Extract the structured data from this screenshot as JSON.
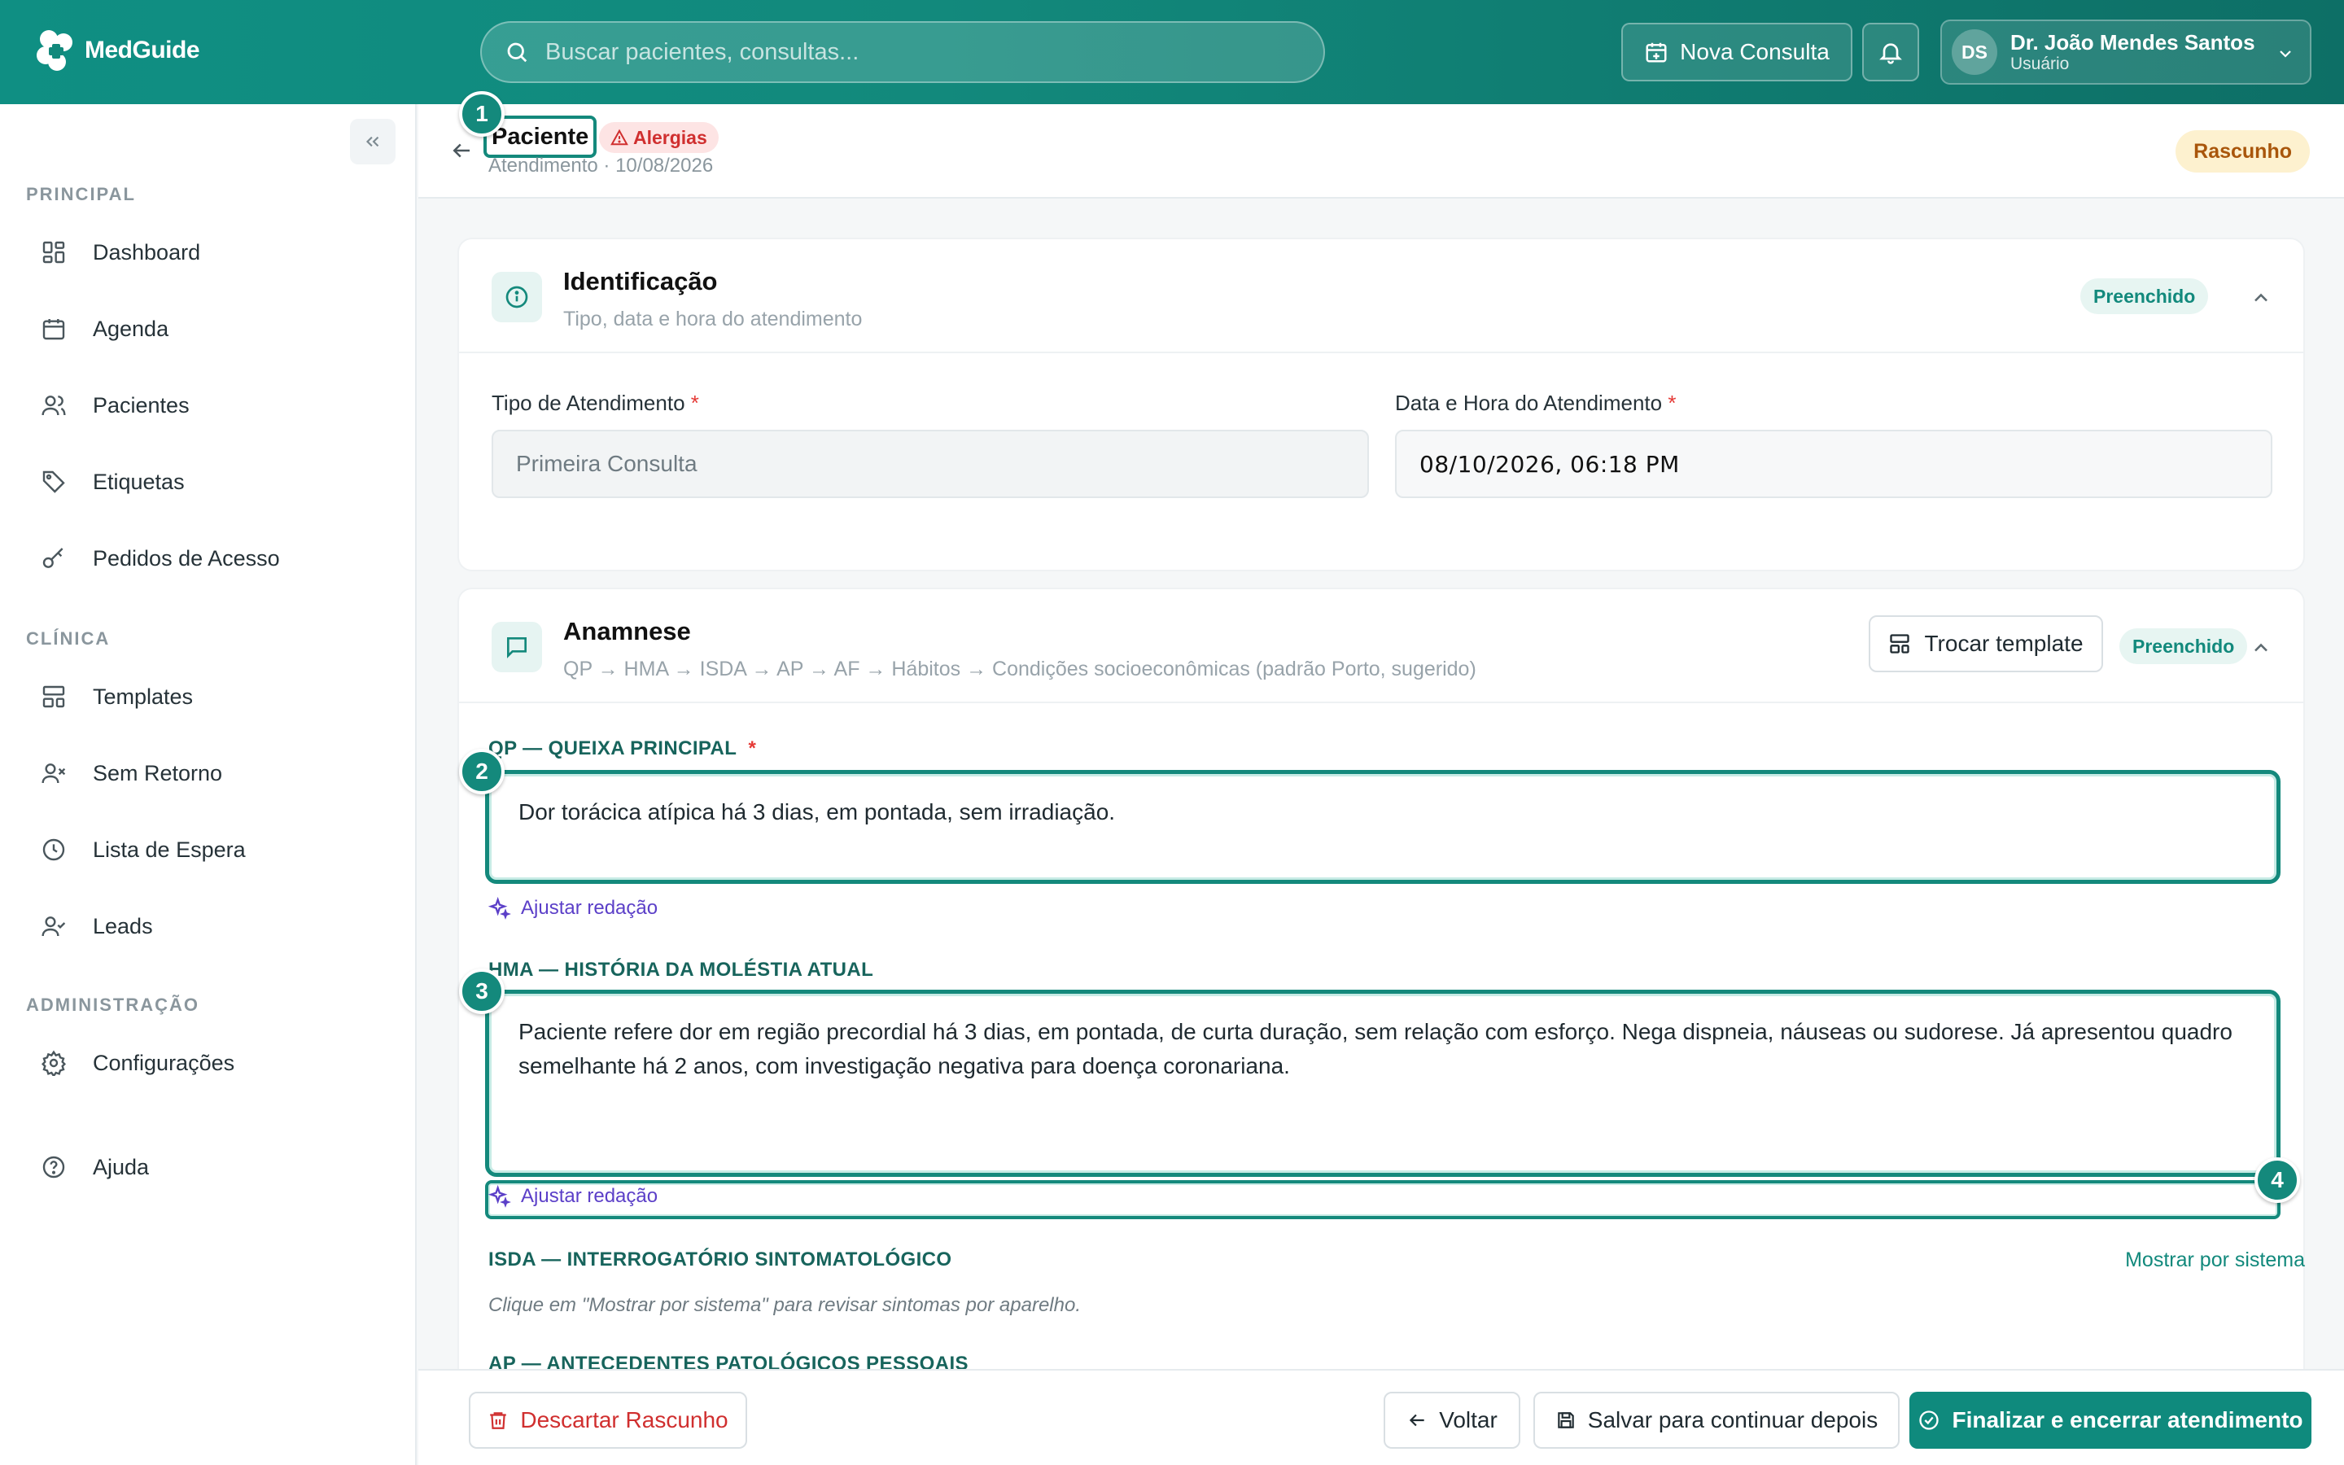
{
  "app": {
    "name": "MedGuide"
  },
  "topbar": {
    "search_placeholder": "Buscar pacientes, consultas...",
    "new_consult_label": "Nova Consulta",
    "user": {
      "initials": "DS",
      "name": "Dr. João Mendes Santos",
      "role": "Usuário"
    }
  },
  "sidebar": {
    "sections": {
      "principal": "PRINCIPAL",
      "clinica": "CLÍNICA",
      "admin": "ADMINISTRAÇÃO"
    },
    "items": [
      {
        "label": "Dashboard",
        "icon": "dashboard-icon"
      },
      {
        "label": "Agenda",
        "icon": "calendar-icon"
      },
      {
        "label": "Pacientes",
        "icon": "users-icon"
      },
      {
        "label": "Etiquetas",
        "icon": "tag-icon"
      },
      {
        "label": "Pedidos de Acesso",
        "icon": "key-icon"
      },
      {
        "label": "Templates",
        "icon": "template-icon"
      },
      {
        "label": "Sem Retorno",
        "icon": "user-x-icon"
      },
      {
        "label": "Lista de Espera",
        "icon": "clock-icon"
      },
      {
        "label": "Leads",
        "icon": "user-check-icon"
      },
      {
        "label": "Configurações",
        "icon": "gear-icon"
      },
      {
        "label": "Ajuda",
        "icon": "help-icon"
      }
    ]
  },
  "header": {
    "patient_label": "Paciente",
    "alert_badge": "Alergias",
    "subline": "Atendimento · 10/08/2026",
    "status": "Rascunho"
  },
  "identificacao": {
    "title": "Identificação",
    "subtitle": "Tipo, data e hora do atendimento",
    "status": "Preenchido",
    "tipo_label": "Tipo de Atendimento",
    "tipo_value": "Primeira Consulta",
    "data_label": "Data e Hora do Atendimento",
    "data_value": "08/10/2026, 06:18 PM",
    "required_mark": "*"
  },
  "anamnese": {
    "title": "Anamnese",
    "subtitle": "QP → HMA → ISDA → AP → AF → Hábitos → Condições socioeconômicas (padrão Porto, sugerido)",
    "trocar_label": "Trocar template",
    "status": "Preenchido",
    "qp_label": "QP — QUEIXA PRINCIPAL",
    "qp_value": "Dor torácica atípica há 3 dias, em pontada, sem irradiação.",
    "hma_label": "HMA — HISTÓRIA DA MOLÉSTIA ATUAL",
    "hma_value": "Paciente refere dor em região precordial há 3 dias, em pontada, de curta duração, sem relação com esforço. Nega dispneia, náuseas ou sudorese. Já apresentou quadro semelhante há 2 anos, com investigação negativa para doença coronariana.",
    "ajustar_label": "Ajustar redação",
    "isda_label": "ISDA — INTERROGATÓRIO SINTOMATOLÓGICO",
    "isda_link": "Mostrar por sistema",
    "isda_hint": "Clique em \"Mostrar por sistema\" para revisar sintomas por aparelho.",
    "ap_label": "AP — ANTECEDENTES PATOLÓGICOS PESSOAIS"
  },
  "markers": [
    "1",
    "2",
    "3",
    "4"
  ],
  "footer": {
    "discard": "Descartar Rascunho",
    "back": "Voltar",
    "save": "Salvar para continuar depois",
    "finish": "Finalizar e encerrar atendimento"
  },
  "colors": {
    "primary": "#0f8a7d",
    "accent_purple": "#5b3fc8",
    "danger": "#d02f2f",
    "draft": "#fdf1cf"
  }
}
